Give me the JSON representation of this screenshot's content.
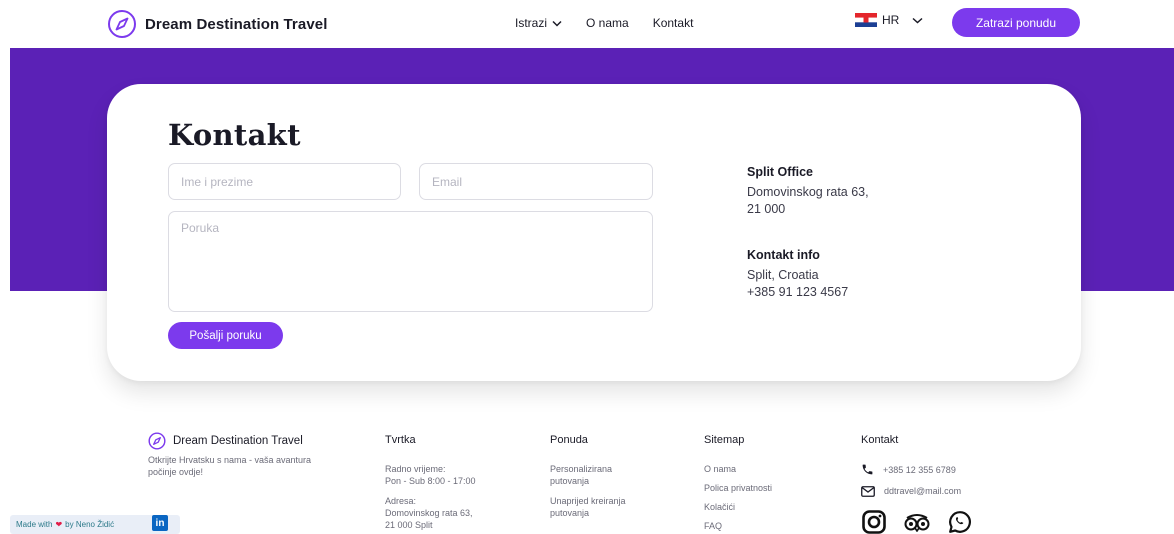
{
  "nav": {
    "brand": "Dream Destination Travel",
    "menu": [
      {
        "label": "Istrazi",
        "has_dropdown": true
      },
      {
        "label": "O nama",
        "has_dropdown": false
      },
      {
        "label": "Kontakt",
        "has_dropdown": false
      }
    ],
    "language": "HR",
    "cta": "Zatrazi ponudu"
  },
  "contact": {
    "title": "Kontakt",
    "name_placeholder": "Ime i prezime",
    "email_placeholder": "Email",
    "message_placeholder": "Poruka",
    "submit": "Pošalji poruku",
    "office": {
      "heading": "Split Office",
      "line1": "Domovinskog rata 63,",
      "line2": "21 000"
    },
    "info": {
      "heading": "Kontakt info",
      "line1": "Split, Croatia",
      "line2": "+385 91 123 4567"
    }
  },
  "footer": {
    "brand": "Dream Destination Travel",
    "tagline": "Otkrijte Hrvatsku s nama - vaša avantura počinje ovdje!",
    "columns": {
      "tvrtka": {
        "heading": "Tvrtka",
        "hours_label": "Radno vrijeme:",
        "hours": "Pon - Sub 8:00 - 17:00",
        "address_label": "Adresa:",
        "address1": "Domovinskog rata 63,",
        "address2": "21 000 Split"
      },
      "ponuda": {
        "heading": "Ponuda",
        "item1a": "Personalizirana",
        "item1b": "putovanja",
        "item2a": "Unaprijed kreiranja",
        "item2b": "putovanja"
      },
      "sitemap": {
        "heading": "Sitemap",
        "links": [
          "O nama",
          "Polica privatnosti",
          "Kolačići",
          "FAQ"
        ]
      },
      "kontakt": {
        "heading": "Kontakt",
        "phone": "+385 12 355 6789",
        "email": "ddtravel@mail.com"
      }
    },
    "socials": [
      "instagram-icon",
      "tripadvisor-icon",
      "whatsapp-icon"
    ]
  },
  "made_with": {
    "prefix": "Made with",
    "suffix": "by Neno Židić",
    "badge": "in"
  },
  "colors": {
    "accent": "#7c3aed",
    "band": "#5b21b6"
  }
}
